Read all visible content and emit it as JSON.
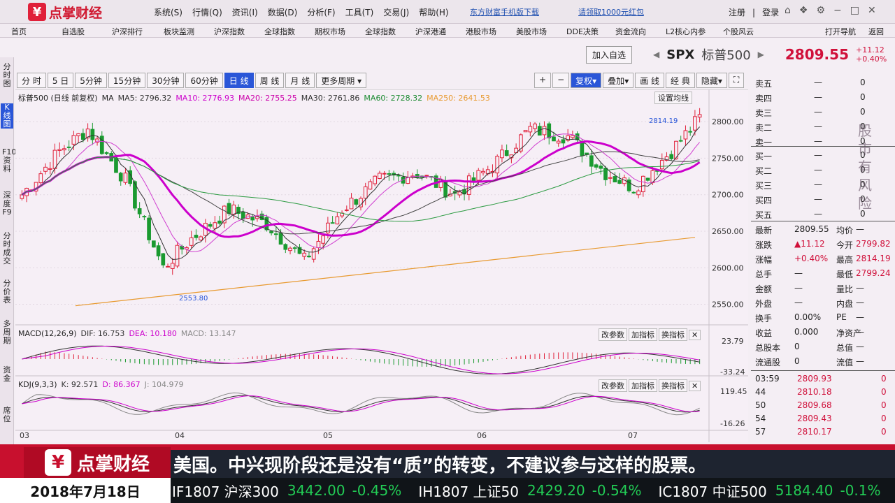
{
  "topbar": {
    "logo_text": "点掌财经",
    "menu": [
      "系统(S)",
      "行情(Q)",
      "资讯(I)",
      "数据(D)",
      "分析(F)",
      "工具(T)",
      "交易(J)",
      "帮助(H)"
    ],
    "promo": [
      "东方财富手机版下载",
      "请领取1000元红包"
    ],
    "account": [
      "注册",
      "登录"
    ]
  },
  "navbar": [
    "首页",
    "自选股",
    "沪深排行",
    "板块监测",
    "沪深指数",
    "全球指数",
    "期权市场",
    "全球指数",
    "沪深港通",
    "港股市场",
    "美股市场",
    "DDE决策",
    "资金流向",
    "L2核心内参",
    "个股风云",
    "打开导航",
    "返回"
  ],
  "leftnav": [
    "分时图",
    "K线图",
    "F10资料",
    "深度F9",
    "分时成交",
    "分价表",
    "多周期",
    "资金",
    "席位"
  ],
  "quote": {
    "add_watch": "加入自选",
    "symbol": "SPX",
    "name": "标普500",
    "price": "2809.55",
    "change": "+11.12",
    "change_pct": "+0.40%"
  },
  "periods": [
    "分 时",
    "5 日",
    "5分钟",
    "15分钟",
    "30分钟",
    "60分钟",
    "日 线",
    "周 线",
    "月 线",
    "更多周期"
  ],
  "periods_selected": 6,
  "tools": [
    "+",
    "−",
    "复权",
    "叠加",
    "画 线",
    "经 典",
    "隐藏"
  ],
  "ma_legend": {
    "title": "标普500 (日线 前复权)",
    "ma_label": "MA",
    "ma5": "MA5: 2796.32",
    "ma10": "MA10: 2776.93",
    "ma20": "MA20: 2755.25",
    "ma30": "MA30: 2761.86",
    "ma60": "MA60: 2728.32",
    "ma250": "MA250: 2641.53",
    "settings": "设置均线"
  },
  "chart_data": {
    "type": "candlestick",
    "price_axis": [
      "2800.00",
      "2750.00",
      "2700.00",
      "2650.00",
      "2600.00",
      "2550.00"
    ],
    "ylim": [
      2540,
      2825
    ],
    "high_label": "2814.19",
    "low_label": "2553.80",
    "months": [
      "03",
      "04",
      "05",
      "06",
      "07"
    ],
    "macd": {
      "title": "MACD(12,26,9)",
      "dif": "DIF: 16.753",
      "dea": "DEA: 10.180",
      "macd": "MACD: 13.147",
      "axis": [
        "23.79",
        "-33.24"
      ]
    },
    "kdj": {
      "title": "KDJ(9,3,3)",
      "k": "K: 92.571",
      "d": "D: 86.367",
      "j": "J: 104.979",
      "axis": [
        "119.45",
        "-16.26"
      ]
    },
    "panel_buttons": [
      "改参数",
      "加指标",
      "换指标"
    ]
  },
  "orderbook": {
    "asks": [
      [
        "卖五",
        "—",
        "0"
      ],
      [
        "卖四",
        "—",
        "0"
      ],
      [
        "卖三",
        "—",
        "0"
      ],
      [
        "卖二",
        "—",
        "0"
      ],
      [
        "卖一",
        "—",
        "0"
      ]
    ],
    "bids": [
      [
        "买一",
        "—",
        "0"
      ],
      [
        "买二",
        "—",
        "0"
      ],
      [
        "买三",
        "—",
        "0"
      ],
      [
        "买四",
        "—",
        "0"
      ],
      [
        "买五",
        "—",
        "0"
      ]
    ],
    "watermark": "股市有风险",
    "stats": [
      [
        "最新",
        "2809.55",
        "均价",
        "—"
      ],
      [
        "涨跌",
        "▲11.12",
        "今开",
        "2799.82"
      ],
      [
        "涨幅",
        "+0.40%",
        "最高",
        "2814.19"
      ],
      [
        "总手",
        "—",
        "最低",
        "2799.24"
      ],
      [
        "金额",
        "—",
        "量比",
        "—"
      ],
      [
        "外盘",
        "—",
        "内盘",
        "—"
      ],
      [
        "换手",
        "0.00%",
        "PE",
        "—"
      ],
      [
        "收益",
        "0.000",
        "净资产",
        "—"
      ],
      [
        "总股本",
        "0",
        "总值",
        "—"
      ],
      [
        "流通股",
        "0",
        "流值",
        "—"
      ]
    ],
    "ticks": [
      [
        "03:59",
        "2809.93",
        "0"
      ],
      [
        "44",
        "2810.18",
        "0"
      ],
      [
        "50",
        "2809.68",
        "0"
      ],
      [
        "54",
        "2809.43",
        "0"
      ],
      [
        "57",
        "2810.17",
        "0"
      ]
    ]
  },
  "ticker": {
    "logo_text": "点掌财经",
    "headline": "美国。中兴现阶段还是没有“质”的转变，不建议参与这样的股票。",
    "date": "2018年7月18日",
    "indices": [
      [
        "IF1807 沪深300",
        "3442.00",
        "-0.45%"
      ],
      [
        "IH1807 上证50",
        "2429.20",
        "-0.54%"
      ],
      [
        "IC1807 中证500",
        "5184.40",
        "-0.1%"
      ]
    ]
  }
}
